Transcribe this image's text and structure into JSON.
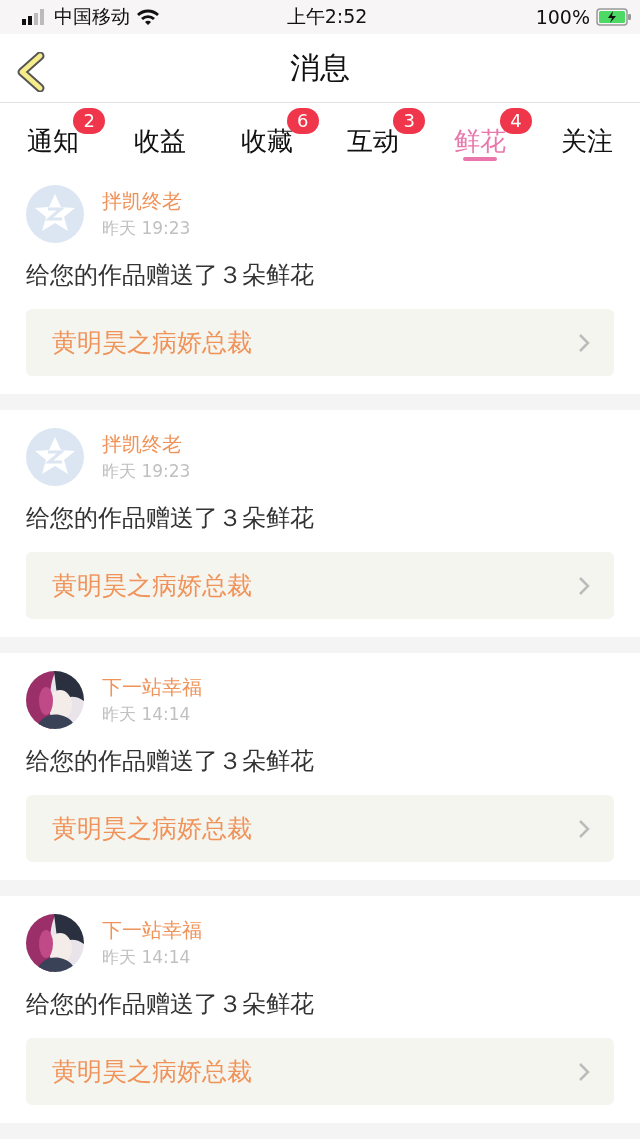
{
  "status_bar": {
    "carrier": "中国移动",
    "time": "上午2:52",
    "battery": "100%"
  },
  "nav": {
    "title": "消息"
  },
  "tabs": [
    {
      "label": "通知",
      "badge": "2",
      "selected": false
    },
    {
      "label": "收益",
      "selected": false
    },
    {
      "label": "收藏",
      "badge": "6",
      "selected": false
    },
    {
      "label": "互动",
      "badge": "3",
      "selected": false
    },
    {
      "label": "鲜花",
      "badge": "4",
      "selected": true
    },
    {
      "label": "关注",
      "selected": false
    }
  ],
  "messages": [
    {
      "kind": "default",
      "user": "拌凯终老",
      "time": "昨天 19:23",
      "text": "给您的作品赠送了３朵鲜花",
      "work": "黄明昊之病娇总裁"
    },
    {
      "kind": "default",
      "user": "拌凯终老",
      "time": "昨天 19:23",
      "text": "给您的作品赠送了３朵鲜花",
      "work": "黄明昊之病娇总裁"
    },
    {
      "kind": "picture",
      "user": "下一站幸福",
      "time": "昨天 14:14",
      "text": "给您的作品赠送了３朵鲜花",
      "work": "黄明昊之病娇总裁"
    },
    {
      "kind": "picture",
      "user": "下一站幸福",
      "time": "昨天 14:14",
      "text": "给您的作品赠送了３朵鲜花",
      "work": "黄明昊之病娇总裁"
    }
  ]
}
